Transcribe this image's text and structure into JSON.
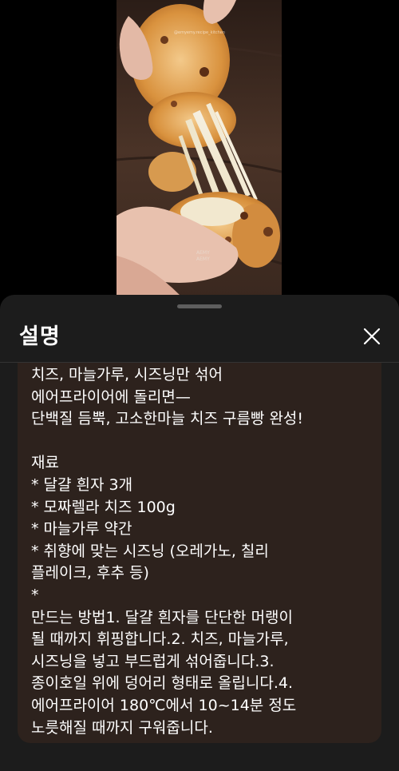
{
  "video": {
    "thumbnail": "cheese-bread-pull-image",
    "overlay_text": "@emyemy.recipe_kitchen",
    "watermark": "ΑΕΜΥ\nΑΕΜΥ"
  },
  "sheet": {
    "title": "설명",
    "close_icon": "close-icon"
  },
  "description": {
    "text": "치즈, 마늘가루, 시즈닝만 섞어\n에어프라이어에 돌리면—\n단백질 듬뿍, 고소한마늘 치즈 구름빵 완성!\n\n재료\n* 달걀 흰자 3개\n* 모짜렐라 치즈 100g\n* 마늘가루 약간\n* 취향에 맞는 시즈닝 (오레가노, 칠리\n플레이크, 후추 등)\n*\n만드는 방법1. 달걀 흰자를 단단한 머랭이\n될 때까지 휘핑합니다.2. 치즈, 마늘가루,\n시즈닝을 넣고 부드럽게 섞어줍니다.3.\n종이호일 위에 덩어리 형태로 올립니다.4.\n에어프라이어 180℃에서 10~14분 정도\n노릇해질 때까지 구워줍니다."
  },
  "colors": {
    "sheet_bg": "#1c1c1c",
    "card_bg": "#2d221d",
    "text": "#ffffff"
  }
}
